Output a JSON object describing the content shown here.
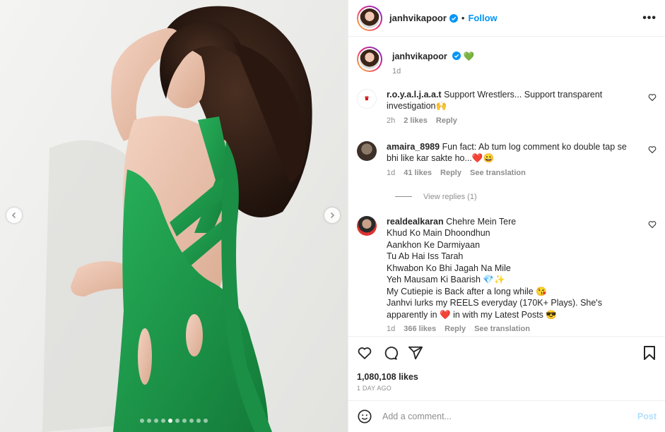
{
  "post": {
    "username": "janhvikapoor",
    "follow_label": "Follow",
    "separator": "•",
    "more_label": "•••"
  },
  "media": {
    "dot_count": 10,
    "active_dot_index": 4,
    "accent_color": "#1f9a4a"
  },
  "caption": {
    "username": "janhvikapoor",
    "emoji": "💚",
    "time": "1d"
  },
  "comments": [
    {
      "username": "r.o.y.a.l.j.a.a.t",
      "lines": [
        "Support Wrestlers... Support transparent",
        "investigation🙌"
      ],
      "time": "2h",
      "likes": "2 likes",
      "reply": "Reply",
      "translate": ""
    },
    {
      "username": "amaira_8989",
      "lines": [
        "Fun fact: Ab tum log comment ko double tap se",
        "bhi like kar sakte ho...❤️😀"
      ],
      "time": "1d",
      "likes": "41 likes",
      "reply": "Reply",
      "translate": "See translation",
      "view_replies": "View replies (1)"
    },
    {
      "username": "realdealkaran",
      "lines": [
        "Chehre Mein Tere",
        "Khud Ko Main Dhoondhun",
        "Aankhon Ke Darmiyaan",
        "Tu Ab Hai Iss Tarah",
        "Khwabon Ko Bhi Jagah Na Mile",
        "Yeh Mausam Ki Baarish 💎✨",
        "My Cutiepie is Back after a long while 😘",
        "Janhvi lurks my REELS everyday (170K+ Plays). She's",
        "apparently in ❤️ in with my Latest Posts 😎"
      ],
      "time": "1d",
      "likes": "366 likes",
      "reply": "Reply",
      "translate": "See translation"
    }
  ],
  "stats": {
    "likes": "1,080,108 likes",
    "ago": "1 DAY AGO"
  },
  "composer": {
    "placeholder": "Add a comment...",
    "post_label": "Post"
  },
  "icons": {
    "like": "heart-icon",
    "comment": "comment-icon",
    "share": "share-icon",
    "save": "bookmark-icon",
    "emoji": "smiley-icon"
  }
}
